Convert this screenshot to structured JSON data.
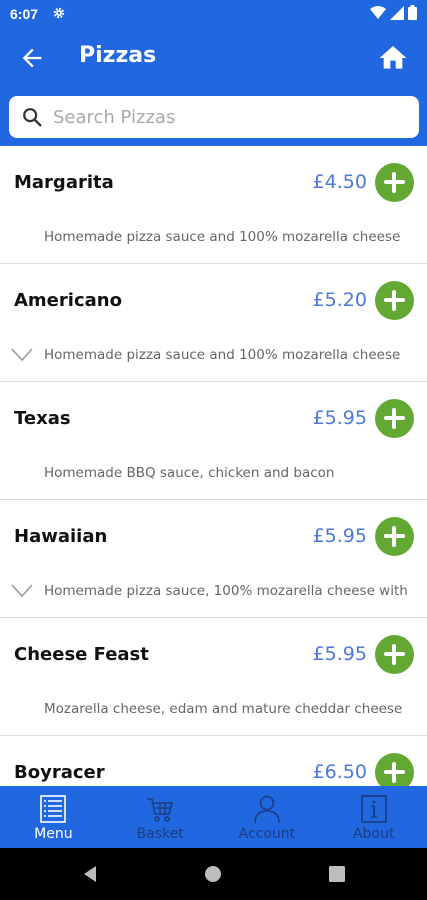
{
  "status_bar": {
    "time": "6:07"
  },
  "app_bar": {
    "title": "Pizzas"
  },
  "search": {
    "placeholder": "Search Pizzas"
  },
  "items": [
    {
      "name": "Margarita",
      "price": "£4.50",
      "description": "Homemade pizza sauce and 100% mozarella cheese",
      "expandable": false
    },
    {
      "name": "Americano",
      "price": "£5.20",
      "description": "Homemade pizza sauce and 100% mozarella cheese",
      "expandable": true
    },
    {
      "name": "Texas",
      "price": "£5.95",
      "description": "Homemade BBQ sauce, chicken and bacon",
      "expandable": false
    },
    {
      "name": "Hawaiian",
      "price": "£5.95",
      "description": "Homemade pizza sauce, 100% mozarella cheese with",
      "expandable": true
    },
    {
      "name": "Cheese Feast",
      "price": "£5.95",
      "description": "Mozarella cheese, edam and mature cheddar cheese",
      "expandable": false
    },
    {
      "name": "Boyracer",
      "price": "£6.50",
      "description": "",
      "expandable": false
    }
  ],
  "bottom_nav": [
    {
      "label": "Menu",
      "icon": "menu-list-icon",
      "active": true
    },
    {
      "label": "Basket",
      "icon": "cart-icon",
      "active": false
    },
    {
      "label": "Account",
      "icon": "person-icon",
      "active": false
    },
    {
      "label": "About",
      "icon": "info-icon",
      "active": false
    }
  ],
  "colors": {
    "primary": "#2167e0",
    "add_button": "#62a832",
    "price": "#4d78d8"
  }
}
